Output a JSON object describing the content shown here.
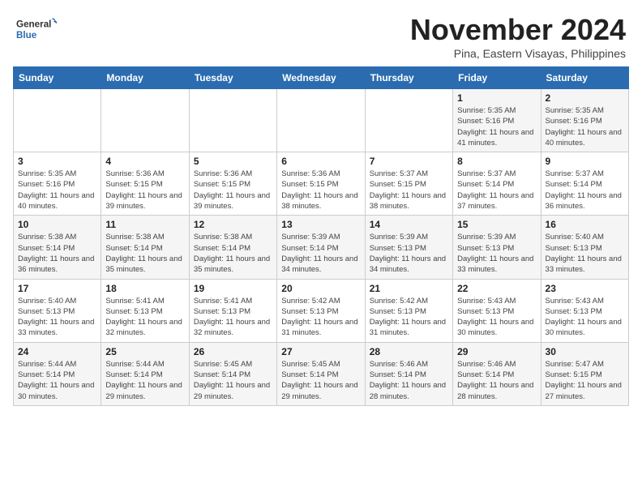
{
  "header": {
    "logo_general": "General",
    "logo_blue": "Blue",
    "month_title": "November 2024",
    "subtitle": "Pina, Eastern Visayas, Philippines"
  },
  "weekdays": [
    "Sunday",
    "Monday",
    "Tuesday",
    "Wednesday",
    "Thursday",
    "Friday",
    "Saturday"
  ],
  "weeks": [
    [
      {
        "day": "",
        "info": ""
      },
      {
        "day": "",
        "info": ""
      },
      {
        "day": "",
        "info": ""
      },
      {
        "day": "",
        "info": ""
      },
      {
        "day": "",
        "info": ""
      },
      {
        "day": "1",
        "info": "Sunrise: 5:35 AM\nSunset: 5:16 PM\nDaylight: 11 hours and 41 minutes."
      },
      {
        "day": "2",
        "info": "Sunrise: 5:35 AM\nSunset: 5:16 PM\nDaylight: 11 hours and 40 minutes."
      }
    ],
    [
      {
        "day": "3",
        "info": "Sunrise: 5:35 AM\nSunset: 5:16 PM\nDaylight: 11 hours and 40 minutes."
      },
      {
        "day": "4",
        "info": "Sunrise: 5:36 AM\nSunset: 5:15 PM\nDaylight: 11 hours and 39 minutes."
      },
      {
        "day": "5",
        "info": "Sunrise: 5:36 AM\nSunset: 5:15 PM\nDaylight: 11 hours and 39 minutes."
      },
      {
        "day": "6",
        "info": "Sunrise: 5:36 AM\nSunset: 5:15 PM\nDaylight: 11 hours and 38 minutes."
      },
      {
        "day": "7",
        "info": "Sunrise: 5:37 AM\nSunset: 5:15 PM\nDaylight: 11 hours and 38 minutes."
      },
      {
        "day": "8",
        "info": "Sunrise: 5:37 AM\nSunset: 5:14 PM\nDaylight: 11 hours and 37 minutes."
      },
      {
        "day": "9",
        "info": "Sunrise: 5:37 AM\nSunset: 5:14 PM\nDaylight: 11 hours and 36 minutes."
      }
    ],
    [
      {
        "day": "10",
        "info": "Sunrise: 5:38 AM\nSunset: 5:14 PM\nDaylight: 11 hours and 36 minutes."
      },
      {
        "day": "11",
        "info": "Sunrise: 5:38 AM\nSunset: 5:14 PM\nDaylight: 11 hours and 35 minutes."
      },
      {
        "day": "12",
        "info": "Sunrise: 5:38 AM\nSunset: 5:14 PM\nDaylight: 11 hours and 35 minutes."
      },
      {
        "day": "13",
        "info": "Sunrise: 5:39 AM\nSunset: 5:14 PM\nDaylight: 11 hours and 34 minutes."
      },
      {
        "day": "14",
        "info": "Sunrise: 5:39 AM\nSunset: 5:13 PM\nDaylight: 11 hours and 34 minutes."
      },
      {
        "day": "15",
        "info": "Sunrise: 5:39 AM\nSunset: 5:13 PM\nDaylight: 11 hours and 33 minutes."
      },
      {
        "day": "16",
        "info": "Sunrise: 5:40 AM\nSunset: 5:13 PM\nDaylight: 11 hours and 33 minutes."
      }
    ],
    [
      {
        "day": "17",
        "info": "Sunrise: 5:40 AM\nSunset: 5:13 PM\nDaylight: 11 hours and 33 minutes."
      },
      {
        "day": "18",
        "info": "Sunrise: 5:41 AM\nSunset: 5:13 PM\nDaylight: 11 hours and 32 minutes."
      },
      {
        "day": "19",
        "info": "Sunrise: 5:41 AM\nSunset: 5:13 PM\nDaylight: 11 hours and 32 minutes."
      },
      {
        "day": "20",
        "info": "Sunrise: 5:42 AM\nSunset: 5:13 PM\nDaylight: 11 hours and 31 minutes."
      },
      {
        "day": "21",
        "info": "Sunrise: 5:42 AM\nSunset: 5:13 PM\nDaylight: 11 hours and 31 minutes."
      },
      {
        "day": "22",
        "info": "Sunrise: 5:43 AM\nSunset: 5:13 PM\nDaylight: 11 hours and 30 minutes."
      },
      {
        "day": "23",
        "info": "Sunrise: 5:43 AM\nSunset: 5:13 PM\nDaylight: 11 hours and 30 minutes."
      }
    ],
    [
      {
        "day": "24",
        "info": "Sunrise: 5:44 AM\nSunset: 5:14 PM\nDaylight: 11 hours and 30 minutes."
      },
      {
        "day": "25",
        "info": "Sunrise: 5:44 AM\nSunset: 5:14 PM\nDaylight: 11 hours and 29 minutes."
      },
      {
        "day": "26",
        "info": "Sunrise: 5:45 AM\nSunset: 5:14 PM\nDaylight: 11 hours and 29 minutes."
      },
      {
        "day": "27",
        "info": "Sunrise: 5:45 AM\nSunset: 5:14 PM\nDaylight: 11 hours and 29 minutes."
      },
      {
        "day": "28",
        "info": "Sunrise: 5:46 AM\nSunset: 5:14 PM\nDaylight: 11 hours and 28 minutes."
      },
      {
        "day": "29",
        "info": "Sunrise: 5:46 AM\nSunset: 5:14 PM\nDaylight: 11 hours and 28 minutes."
      },
      {
        "day": "30",
        "info": "Sunrise: 5:47 AM\nSunset: 5:15 PM\nDaylight: 11 hours and 27 minutes."
      }
    ]
  ]
}
